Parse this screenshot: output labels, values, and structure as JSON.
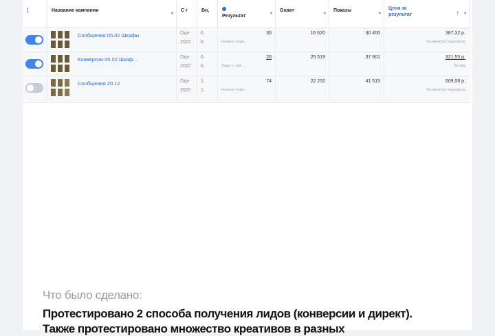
{
  "table": {
    "headers": {
      "col_toggle": "¦",
      "col_name": "Название кампании",
      "col_status": "С г",
      "col_delivery": "Вн,",
      "col_result": "Результат",
      "col_reach": "Охват",
      "col_impressions": "Показы",
      "col_cost": "Цена за результат"
    },
    "rows": [
      {
        "enabled": true,
        "name": "Сообщения 05.02 Шкафы",
        "status_a": "Оце",
        "status_b": "2022",
        "delivery_a": "6.",
        "delivery_b": "6.",
        "result": "35",
        "result_sub": "Начало пере...",
        "reach": "16 620",
        "impressions": "30 400",
        "cost": "387,32 р.",
        "cost_sub": "За начатую переписку"
      },
      {
        "enabled": true,
        "name": "Конверсии 05.02 Шкаф...",
        "status_a": "Оце",
        "status_b": "2022",
        "delivery_a": "6.",
        "delivery_b": "6.",
        "result": "26",
        "result_sub": "Лиды с сай...",
        "reach": "25 519",
        "impressions": "37 901",
        "cost": "321,55 р.",
        "cost_sub": "За лид"
      },
      {
        "enabled": false,
        "name": "Сообщения 20.12",
        "status_a": "Оце",
        "status_b": "2022",
        "delivery_a": "1.",
        "delivery_b": "1.",
        "result": "74",
        "result_sub": "Начало пере...",
        "reach": "22 232",
        "impressions": "41 515",
        "cost": "609,08 р.",
        "cost_sub": "За начатую переписку"
      }
    ]
  },
  "text": {
    "what_was_done": "Что было сделано:",
    "line1": "Протестировано 2 способа получения лидов (конверсии и директ).",
    "line2": "Также протестировано множество креативов в разных"
  },
  "colors": {
    "toggle_on": "#3f86e8",
    "toggle_off": "#c9ccd2",
    "link": "#2a6ccf"
  }
}
